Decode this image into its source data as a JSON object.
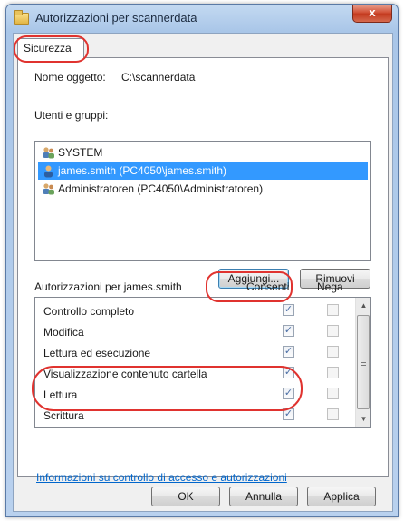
{
  "window": {
    "title": "Autorizzazioni per scannerdata",
    "close_glyph": "x"
  },
  "tabs": [
    {
      "label": "Sicurezza"
    }
  ],
  "object": {
    "label": "Nome oggetto:",
    "value": "C:\\scannerdata"
  },
  "users": {
    "label": "Utenti e gruppi:",
    "items": [
      {
        "label": "SYSTEM",
        "icon": "group-icon",
        "selected": false
      },
      {
        "label": "james.smith (PC4050\\james.smith)",
        "icon": "user-icon",
        "selected": true
      },
      {
        "label": "Administratoren (PC4050\\Administratoren)",
        "icon": "group-icon",
        "selected": false
      }
    ]
  },
  "buttons": {
    "add": "Aggiungi...",
    "remove": "Rimuovi",
    "ok": "OK",
    "cancel": "Annulla",
    "apply": "Applica"
  },
  "permissions": {
    "title": "Autorizzazioni per james.smith",
    "col_allow": "Consenti",
    "col_deny": "Nega",
    "rows": [
      {
        "name": "Controllo completo",
        "allow": true,
        "deny": false
      },
      {
        "name": "Modifica",
        "allow": true,
        "deny": false
      },
      {
        "name": "Lettura ed esecuzione",
        "allow": true,
        "deny": false
      },
      {
        "name": "Visualizzazione contenuto cartella",
        "allow": true,
        "deny": false
      },
      {
        "name": "Lettura",
        "allow": true,
        "deny": false
      },
      {
        "name": "Scrittura",
        "allow": true,
        "deny": false
      }
    ]
  },
  "link": "Informazioni su controllo di accesso e autorizzazioni",
  "colors": {
    "selection": "#3399ff",
    "highlight_oval": "#e0332f",
    "link": "#0066cc",
    "check": "#4a6ea5"
  }
}
